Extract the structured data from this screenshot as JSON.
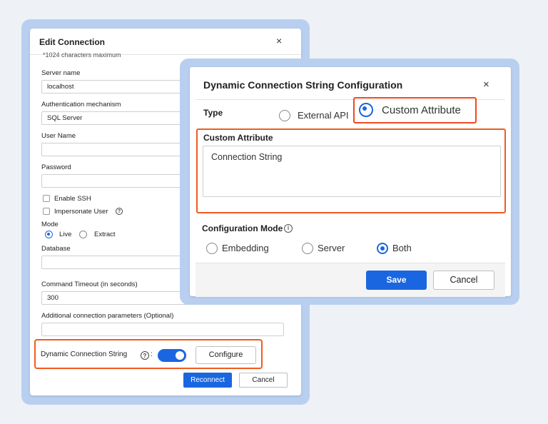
{
  "edit_dialog": {
    "title": "Edit Connection",
    "close_glyph": "×",
    "note": "*1024 characters maximum",
    "server_name": {
      "label": "Server name",
      "value": "localhost"
    },
    "auth": {
      "label": "Authentication mechanism",
      "value": "SQL Server"
    },
    "user_name": {
      "label": "User Name",
      "value": ""
    },
    "password": {
      "label": "Password",
      "value": ""
    },
    "enable_ssh": {
      "label": "Enable SSH",
      "checked": false
    },
    "impersonate_user": {
      "label": "Impersonate User",
      "checked": false,
      "help_glyph": "?"
    },
    "mode": {
      "label": "Mode",
      "options": [
        "Live",
        "Extract"
      ],
      "selected": "Live"
    },
    "database": {
      "label": "Database",
      "value": ""
    },
    "command_timeout": {
      "label": "Command Timeout (in seconds)",
      "value": "300"
    },
    "additional_params": {
      "label": "Additional connection parameters (Optional)",
      "value": ""
    },
    "dynamic_connection_string": {
      "label": "Dynamic Connection String",
      "help_glyph": "?",
      "colon": ":",
      "enabled": true
    },
    "configure_label": "Configure",
    "reconnect_label": "Reconnect",
    "cancel_label": "Cancel"
  },
  "dcs_dialog": {
    "title": "Dynamic Connection String Configuration",
    "close_glyph": "×",
    "type": {
      "label": "Type",
      "options": [
        "External API",
        "Custom Attribute"
      ],
      "selected": "Custom Attribute"
    },
    "custom_attribute": {
      "label": "Custom Attribute",
      "value": "Connection String"
    },
    "configuration_mode": {
      "label": "Configuration Mode",
      "info_glyph": "i",
      "options": [
        "Embedding",
        "Server",
        "Both"
      ],
      "selected": "Both"
    },
    "save_label": "Save",
    "cancel_label": "Cancel"
  },
  "colors": {
    "accent": "#1a66e0",
    "highlight": "#f05b1e",
    "frame": "#b9cff0",
    "background": "#eef2f7"
  }
}
